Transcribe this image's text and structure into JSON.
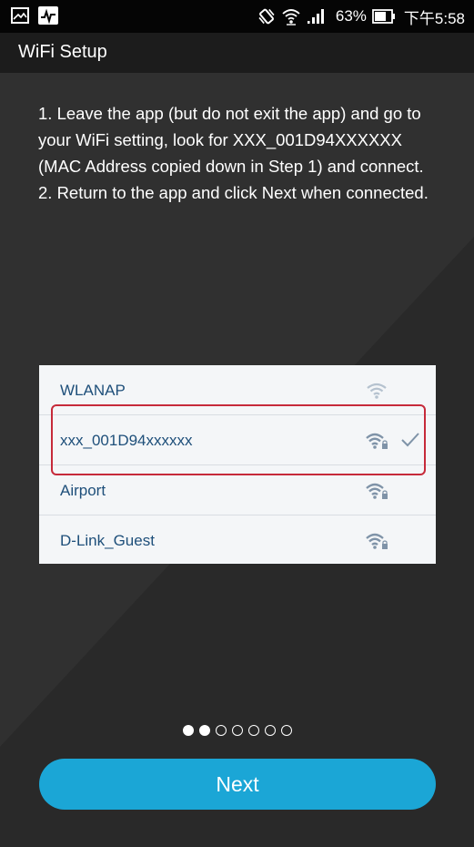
{
  "status_bar": {
    "battery_percent": "63%",
    "time": "下午5:58",
    "icons": [
      "image-notification-icon",
      "activity-icon",
      "vibrate-icon",
      "wifi-icon",
      "cell-signal-icon",
      "battery-icon"
    ]
  },
  "header": {
    "title": "WiFi Setup"
  },
  "instructions": {
    "step1": "1. Leave the app (but do not exit the app) and go to your WiFi setting, look for XXX_001D94XXXXXX (MAC Address copied down in Step 1) and connect.",
    "step2": "2. Return to the app and click Next when connected."
  },
  "wifi_list": {
    "networks": [
      {
        "name": "WLANAP",
        "secured": false,
        "selected": false
      },
      {
        "name": "xxx_001D94xxxxxx",
        "secured": true,
        "selected": true
      },
      {
        "name": "Airport",
        "secured": true,
        "selected": false
      },
      {
        "name": "D-Link_Guest",
        "secured": true,
        "selected": false
      }
    ],
    "highlight_color": "#c62a3a",
    "text_color": "#1e4f7a"
  },
  "pager": {
    "total_pages": 7,
    "current_page": 2
  },
  "next_button": {
    "label": "Next",
    "color": "#1ba6d6"
  }
}
